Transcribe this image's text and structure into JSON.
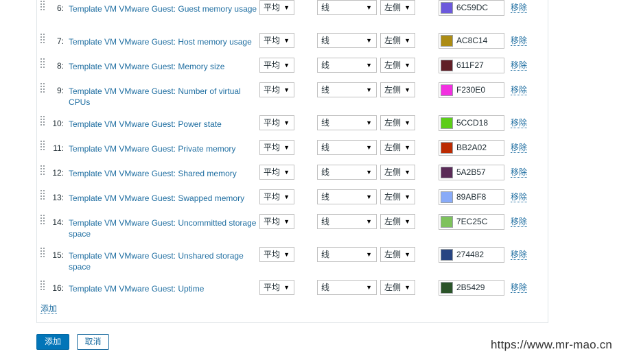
{
  "items": [
    {
      "num": "6:",
      "name": "Template VM VMware Guest: Guest memory usage",
      "function": "平均",
      "draw_style": "线",
      "y_axis": "左侧",
      "color": "6C59DC",
      "remove": "移除"
    },
    {
      "num": "7:",
      "name": "Template VM VMware Guest: Host memory usage",
      "function": "平均",
      "draw_style": "线",
      "y_axis": "左侧",
      "color": "AC8C14",
      "remove": "移除"
    },
    {
      "num": "8:",
      "name": "Template VM VMware Guest: Memory size",
      "function": "平均",
      "draw_style": "线",
      "y_axis": "左侧",
      "color": "611F27",
      "remove": "移除"
    },
    {
      "num": "9:",
      "name": "Template VM VMware Guest: Number of virtual CPUs",
      "function": "平均",
      "draw_style": "线",
      "y_axis": "左侧",
      "color": "F230E0",
      "remove": "移除"
    },
    {
      "num": "10:",
      "name": "Template VM VMware Guest: Power state",
      "function": "平均",
      "draw_style": "线",
      "y_axis": "左侧",
      "color": "5CCD18",
      "remove": "移除"
    },
    {
      "num": "11:",
      "name": "Template VM VMware Guest: Private memory",
      "function": "平均",
      "draw_style": "线",
      "y_axis": "左侧",
      "color": "BB2A02",
      "remove": "移除"
    },
    {
      "num": "12:",
      "name": "Template VM VMware Guest: Shared memory",
      "function": "平均",
      "draw_style": "线",
      "y_axis": "左侧",
      "color": "5A2B57",
      "remove": "移除"
    },
    {
      "num": "13:",
      "name": "Template VM VMware Guest: Swapped memory",
      "function": "平均",
      "draw_style": "线",
      "y_axis": "左侧",
      "color": "89ABF8",
      "remove": "移除"
    },
    {
      "num": "14:",
      "name": "Template VM VMware Guest: Uncommitted storage space",
      "function": "平均",
      "draw_style": "线",
      "y_axis": "左侧",
      "color": "7EC25C",
      "remove": "移除"
    },
    {
      "num": "15:",
      "name": "Template VM VMware Guest: Unshared storage space",
      "function": "平均",
      "draw_style": "线",
      "y_axis": "左侧",
      "color": "274482",
      "remove": "移除"
    },
    {
      "num": "16:",
      "name": "Template VM VMware Guest: Uptime",
      "function": "平均",
      "draw_style": "线",
      "y_axis": "左侧",
      "color": "2B5429",
      "remove": "移除"
    }
  ],
  "add_item_label": "添加",
  "buttons": {
    "add": "添加",
    "cancel": "取消"
  },
  "watermark": "https://www.mr-mao.cn"
}
